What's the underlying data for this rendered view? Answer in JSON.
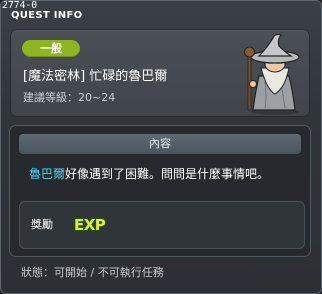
{
  "window": {
    "quest_id": "2774-0",
    "title": "QUEST INFO"
  },
  "quest": {
    "category_badge": "一般",
    "name": "[魔法密林] 忙碌的魯巴爾",
    "level_range": "建議等級：20~24",
    "npc_icon": "npc-wizard-portrait"
  },
  "content": {
    "header": "內容",
    "description_highlight": "魯巴爾",
    "description_rest": "好像遇到了困難。問問是什麼事情吧。"
  },
  "reward": {
    "label": "獎勵",
    "exp_label": "EXP"
  },
  "status": {
    "text": "狀態：可開始 / 不可執行任務"
  },
  "colors": {
    "badge": "#8fb51f",
    "highlight": "#4ad8f0",
    "exp_text": "#d9f02a",
    "exp_outline": "#2a5a18"
  }
}
